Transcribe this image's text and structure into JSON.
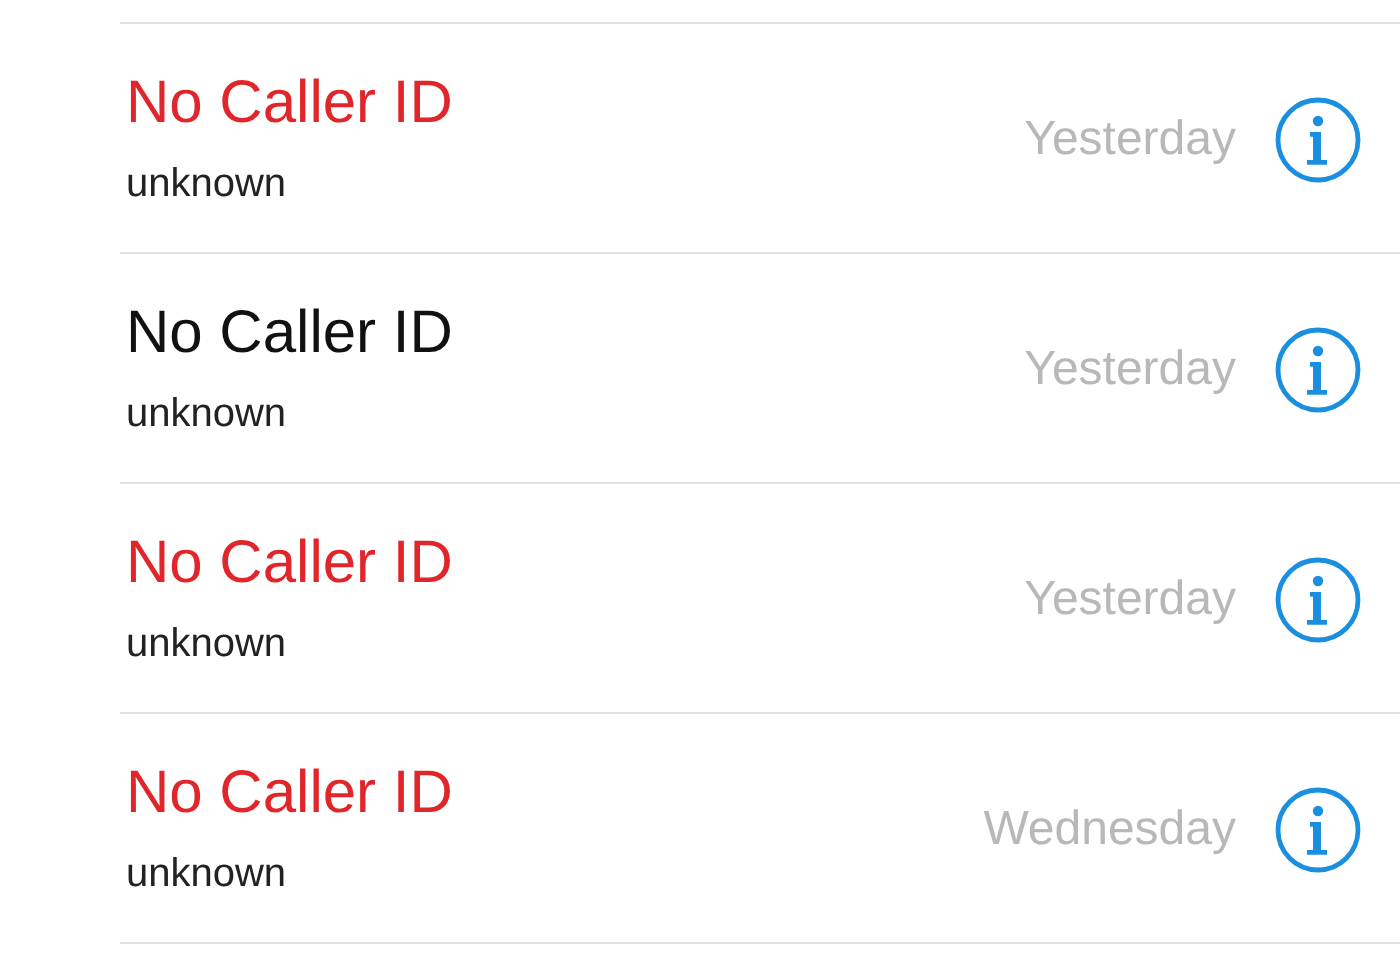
{
  "calls": [
    {
      "name": "No Caller ID",
      "missed": true,
      "label": "unknown",
      "date": "Yesterday"
    },
    {
      "name": "No Caller ID",
      "missed": false,
      "label": "unknown",
      "date": "Yesterday"
    },
    {
      "name": "No Caller ID",
      "missed": true,
      "label": "unknown",
      "date": "Yesterday"
    },
    {
      "name": "No Caller ID",
      "missed": true,
      "label": "unknown",
      "date": "Wednesday"
    }
  ]
}
